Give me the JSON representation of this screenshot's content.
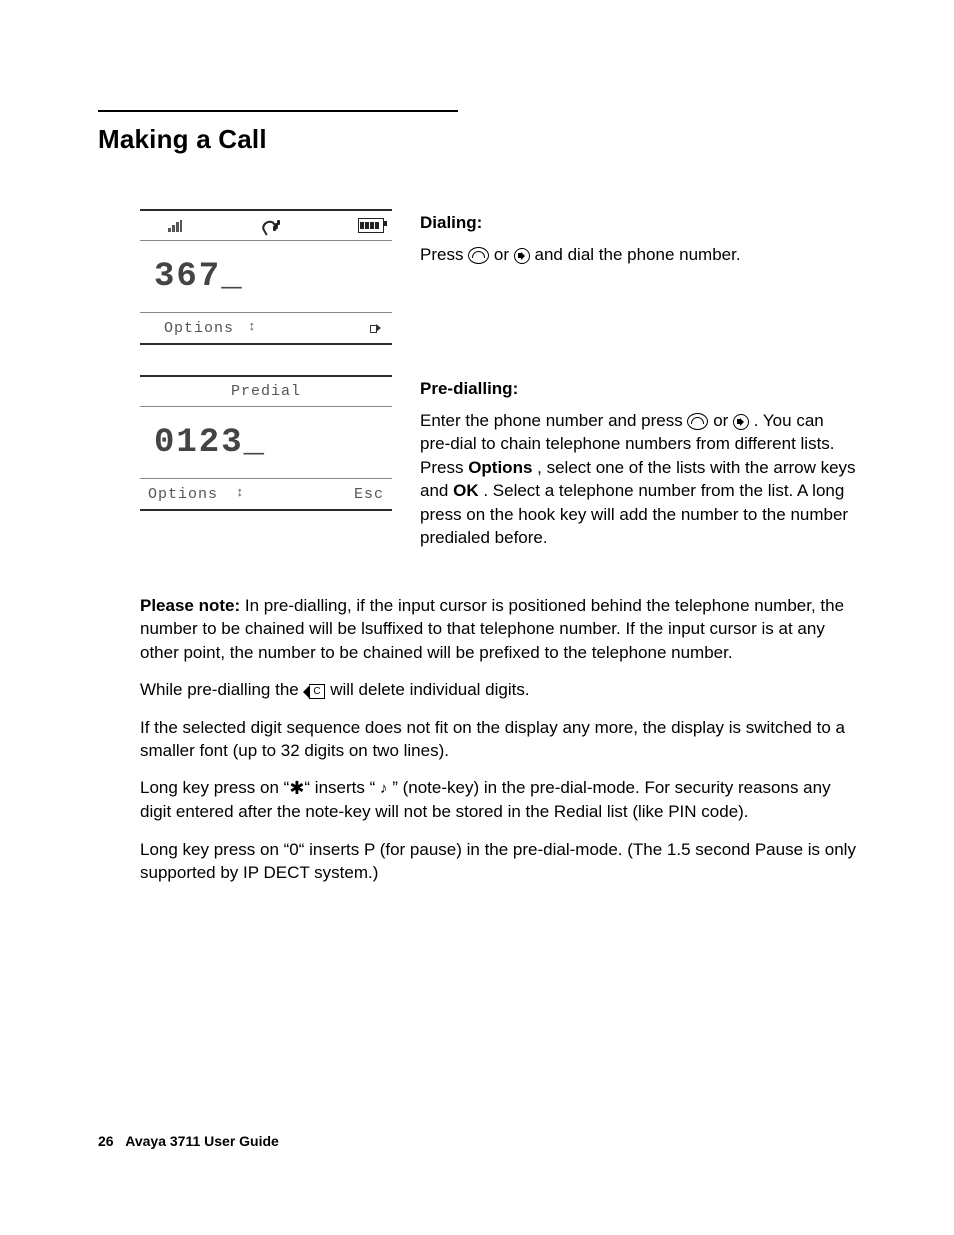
{
  "section_title": "Making a Call",
  "dialing": {
    "heading": "Dialing:",
    "text_before": "Press ",
    "text_mid": " or ",
    "text_after": " and dial the phone number."
  },
  "predialling": {
    "heading": "Pre-dialling:",
    "text_before": "Enter the phone number and press ",
    "text_mid": " or ",
    "text_after": ". You can pre-dial to chain telephone numbers from different lists. Press ",
    "options_word": "Options",
    "text_after2": ", select one of the lists with the arrow keys and ",
    "ok_word": "OK",
    "text_after3": ". Select a telephone number from the list. A long press on the hook key will add the number to the number predialed before."
  },
  "screen1": {
    "digits": "367_",
    "soft_left": "Options"
  },
  "screen2": {
    "title": "Predial",
    "digits": "0123_",
    "soft_left": "Options",
    "soft_right": "Esc"
  },
  "notes": {
    "p1_lead": "Please note:",
    "p1_body": " In pre-dialling, if the input cursor is positioned behind the telephone number, the number to be chained will be lsuffixed to that telephone number. If the input cursor is at any other point, the number to be chained will be prefixed to the telephone number.",
    "p2_before": "While pre-dialling the ",
    "p2_after": " will delete individual digits.",
    "p3": "If the selected digit sequence does not fit on the display any more, the display is switched to a smaller font (up to 32 digits on two lines).",
    "p4_before": "Long key press on “",
    "p4_star": "✱",
    "p4_mid1": "“ inserts “ ",
    "p4_note": "♪",
    "p4_mid2": " ” (note-key) in the pre-dial-mode. For security reasons any digit entered after the note-key will not be stored in the Redial list (like PIN code).",
    "p5": "Long key press on “0“ inserts P (for pause) in the pre-dial-mode. (The 1.5 second Pause is only supported by IP DECT system.)"
  },
  "footer": {
    "page_number": "26",
    "doc_title": "Avaya 3711 User Guide"
  }
}
